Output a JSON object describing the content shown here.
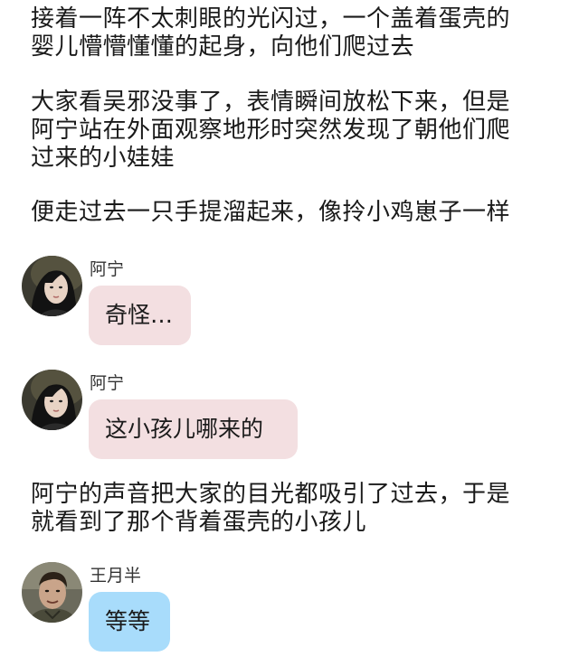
{
  "story": {
    "p1": "接着一阵不太刺眼的光闪过，一个盖着蛋壳的\n婴儿懵懵懂懂的起身，向他们爬过去",
    "p2": "大家看吴邪没事了，表情瞬间放松下来，但是\n阿宁站在外面观察地形时突然发现了朝他们爬\n过来的小娃娃",
    "p3": "便走过去一只手提溜起来，像拎小鸡崽子一样",
    "p4": "阿宁的声音把大家的目光都吸引了过去，于是\n就看到了那个背着蛋壳的小孩儿"
  },
  "messages": [
    {
      "speaker": "阿宁",
      "text": "奇怪…",
      "bubble_color": "#f3dfe1"
    },
    {
      "speaker": "阿宁",
      "text": "这小孩儿哪来的",
      "bubble_color": "#f3dfe1"
    },
    {
      "speaker": "王月半",
      "text": "等等",
      "bubble_color": "#a8dcfb"
    }
  ],
  "icons": {
    "avatar_1": "woman-portrait-avatar",
    "avatar_2": "woman-portrait-avatar",
    "avatar_3": "man-portrait-avatar"
  }
}
